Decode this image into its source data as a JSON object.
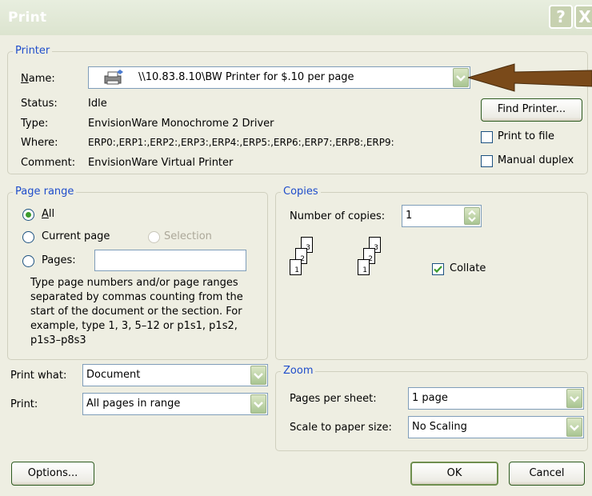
{
  "window": {
    "title": "Print",
    "help_button": "?",
    "close_button": "X"
  },
  "printer": {
    "group_label": "Printer",
    "name_label": "Name:",
    "name_value": "\\\\10.83.8.10\\BW Printer for $.10 per page",
    "status_label": "Status:",
    "status_value": "Idle",
    "type_label": "Type:",
    "type_value": "EnvisionWare Monochrome 2 Driver",
    "where_label": "Where:",
    "where_value": "ERP0:,ERP1:,ERP2:,ERP3:,ERP4:,ERP5:,ERP6:,ERP7:,ERP8:,ERP9:",
    "comment_label": "Comment:",
    "comment_value": "EnvisionWare Virtual Printer",
    "find_printer_button": "Find Printer...",
    "print_to_file_label": "Print to file",
    "manual_duplex_label": "Manual duplex"
  },
  "page_range": {
    "group_label": "Page range",
    "all_label": "All",
    "current_page_label": "Current page",
    "selection_label": "Selection",
    "pages_label": "Pages:",
    "pages_value": "",
    "help_text": "Type page numbers and/or page ranges separated by commas counting from the start of the document or the section. For example, type 1, 3, 5–12 or p1s1, p1s2, p1s3–p8s3",
    "selected": "All"
  },
  "copies": {
    "group_label": "Copies",
    "number_label": "Number of copies:",
    "number_value": "1",
    "collate_label": "Collate",
    "collate_checked": true,
    "page_numbers": [
      "1",
      "2",
      "3"
    ]
  },
  "print_what": {
    "label": "Print what:",
    "value": "Document"
  },
  "print": {
    "label": "Print:",
    "value": "All pages in range"
  },
  "zoom": {
    "group_label": "Zoom",
    "pages_per_sheet_label": "Pages per sheet:",
    "pages_per_sheet_value": "1 page",
    "scale_label": "Scale to paper size:",
    "scale_value": "No Scaling"
  },
  "buttons": {
    "options": "Options...",
    "ok": "OK",
    "cancel": "Cancel"
  },
  "colors": {
    "accent_green": "#3d9b2d",
    "group_label_blue": "#1f4dcb",
    "arrow_brown": "#7a4a1a"
  }
}
